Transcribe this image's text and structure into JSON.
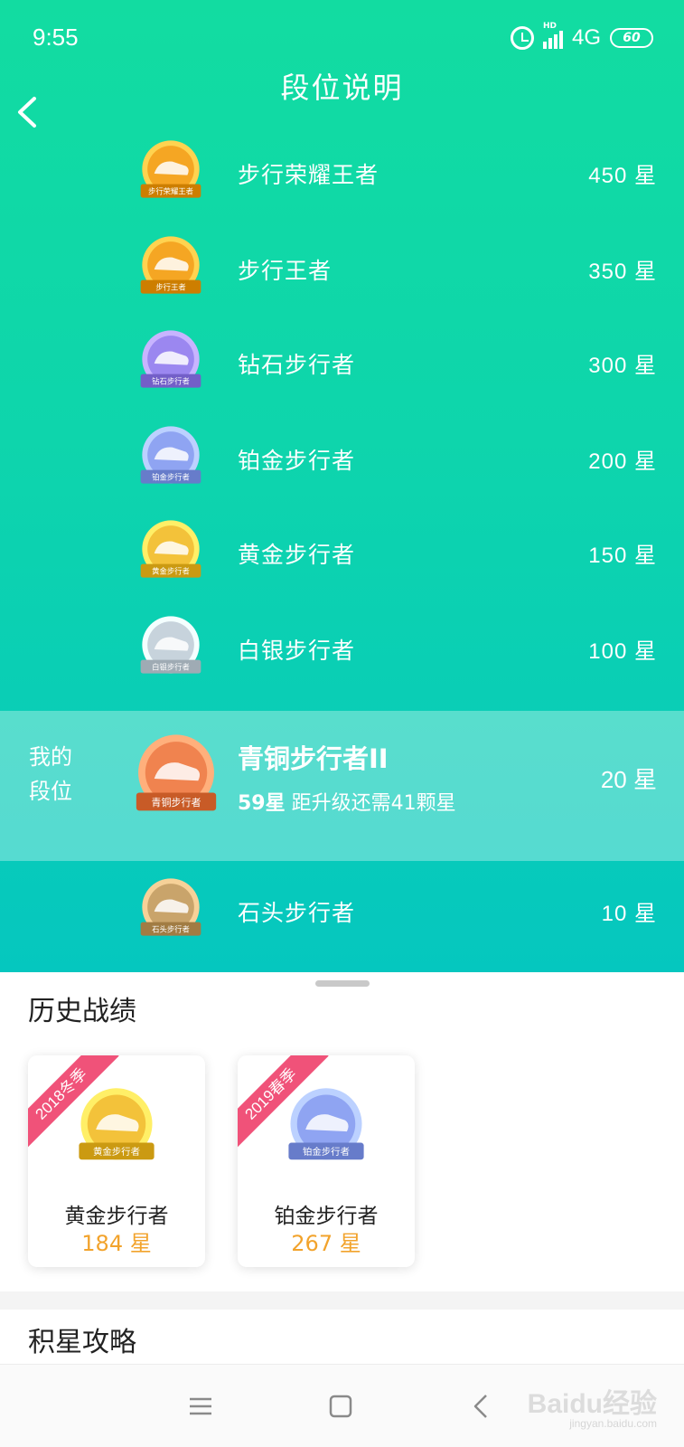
{
  "status_bar": {
    "time": "9:55",
    "network": "4G",
    "battery": "60",
    "hd": "HD"
  },
  "header": {
    "title": "段位说明",
    "back_icon": "chevron-left-icon"
  },
  "ranks": [
    {
      "name": "步行荣耀王者",
      "stars": "450 星",
      "badge_text": "步行荣耀王者",
      "color": "#f5a623"
    },
    {
      "name": "步行王者",
      "stars": "350 星",
      "badge_text": "步行王者",
      "color": "#f5a623"
    },
    {
      "name": "钻石步行者",
      "stars": "300 星",
      "badge_text": "钻石步行者",
      "color": "#9b87f0"
    },
    {
      "name": "铂金步行者",
      "stars": "200 星",
      "badge_text": "铂金步行者",
      "color": "#8fa4f2"
    },
    {
      "name": "黄金步行者",
      "stars": "150 星",
      "badge_text": "黄金步行者",
      "color": "#f3c23a"
    },
    {
      "name": "白银步行者",
      "stars": "100 星",
      "badge_text": "白银步行者",
      "color": "#c7d3dc"
    }
  ],
  "my_rank": {
    "label_line1": "我的",
    "label_line2": "段位",
    "name": "青铜步行者II",
    "current_stars": "59星",
    "progress_text": "距升级还需41颗星",
    "stars": "20 星",
    "badge_text": "青铜步行者",
    "color": "#f0834f"
  },
  "lower_rank": {
    "name": "石头步行者",
    "stars": "10 星",
    "badge_text": "石头步行者",
    "color": "#c9a46b"
  },
  "history": {
    "title": "历史战绩",
    "cards": [
      {
        "season": "2018冬季",
        "name": "黄金步行者",
        "stars": "184 星",
        "badge_text": "黄金步行者",
        "color": "#f3c23a"
      },
      {
        "season": "2019春季",
        "name": "铂金步行者",
        "stars": "267 星",
        "badge_text": "铂金步行者",
        "color": "#8fa4f2"
      }
    ]
  },
  "tips": {
    "title": "积星攻略"
  },
  "navbar": {
    "menu_icon": "menu-icon",
    "home_icon": "home-square-icon",
    "back_icon": "back-triangle-icon"
  },
  "watermark": {
    "text": "Baidu经验",
    "sub": "jingyan.baidu.com"
  }
}
